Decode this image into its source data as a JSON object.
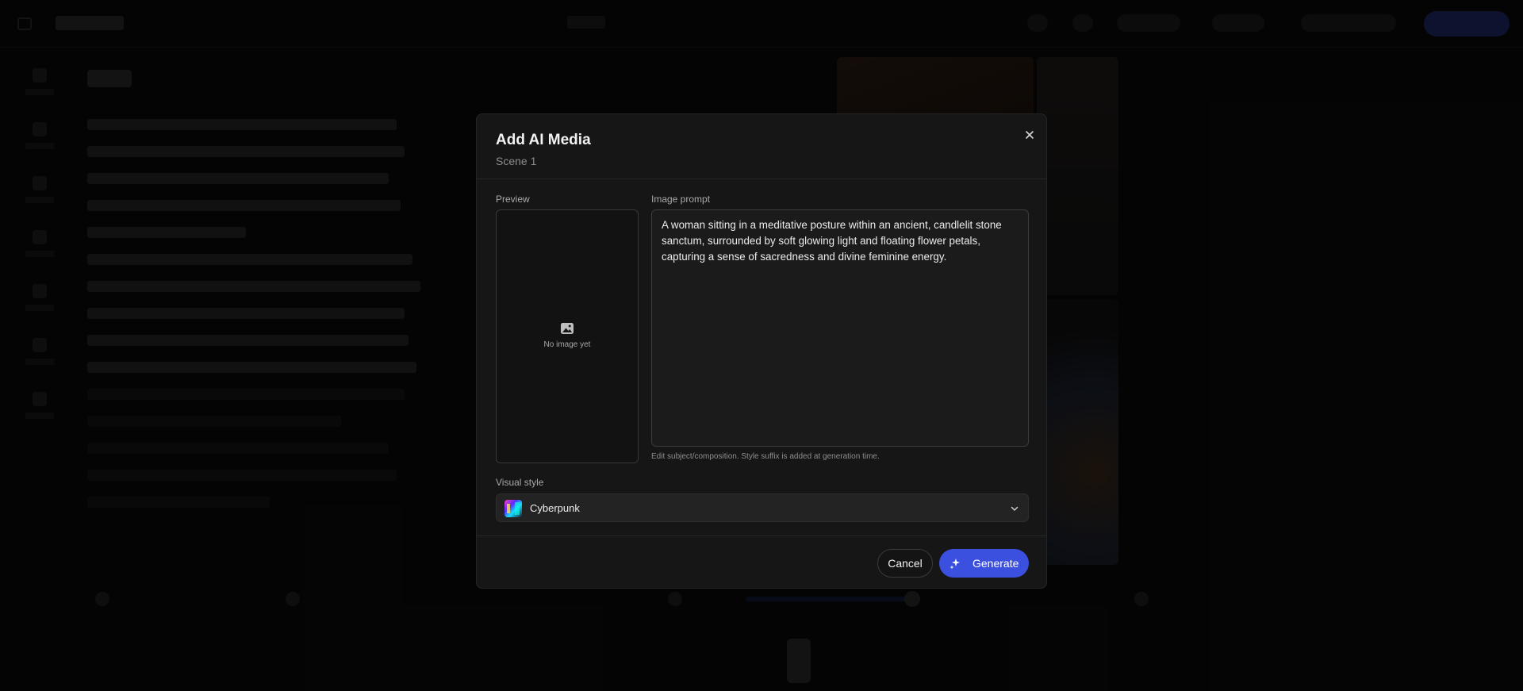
{
  "modal": {
    "title": "Add AI Media",
    "subtitle": "Scene 1",
    "close_icon": "close-icon",
    "preview_label": "Preview",
    "preview_empty_text": "No image yet",
    "preview_icon": "image-icon",
    "prompt_label": "Image prompt",
    "prompt_value": "A woman sitting in a meditative posture within an ancient, candlelit stone sanctum, surrounded by soft glowing light and floating flower petals, capturing a sense of sacredness and divine feminine energy.",
    "prompt_hint": "Edit subject/composition. Style suffix is added at generation time.",
    "visual_style_label": "Visual style",
    "visual_style_value": "Cyberpunk",
    "visual_style_icon": "chevron-down-icon",
    "cancel_label": "Cancel",
    "generate_label": "Generate",
    "generate_icon": "sparkle-icon"
  },
  "colors": {
    "accent": "#3c50e0",
    "modal_bg": "#161616",
    "overlay": "#000000"
  }
}
